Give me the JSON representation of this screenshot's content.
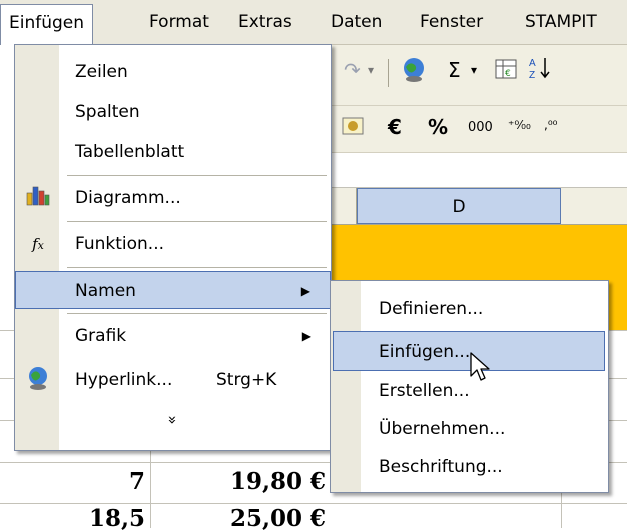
{
  "menubar": {
    "items": [
      {
        "label": "Einfügen"
      },
      {
        "label": "Format"
      },
      {
        "label": "Extras"
      },
      {
        "label": "Daten"
      },
      {
        "label": "Fenster"
      },
      {
        "label": "STAMPIT"
      }
    ]
  },
  "toolbar": {
    "sigma": "Σ",
    "euro": "€",
    "percent": "%",
    "thousands": "000",
    "dec_inc": "⁺⁰⁄₀₀",
    "dec_dec": ",⁰⁰"
  },
  "grid": {
    "column_header": "D",
    "cells": [
      {
        "value": "7",
        "amount": "19,80 €"
      },
      {
        "value": "18,5",
        "amount": "25,00 €"
      }
    ]
  },
  "menu": {
    "items": [
      {
        "label": "Zeilen"
      },
      {
        "label": "Spalten"
      },
      {
        "label": "Tabellenblatt"
      },
      {
        "label": "Diagramm..."
      },
      {
        "label": "Funktion..."
      },
      {
        "label": "Namen"
      },
      {
        "label": "Grafik"
      },
      {
        "label": "Hyperlink...",
        "shortcut": "Strg+K"
      }
    ],
    "expand": "»"
  },
  "submenu": {
    "items": [
      {
        "label": "Definieren..."
      },
      {
        "label": "Einfügen..."
      },
      {
        "label": "Erstellen..."
      },
      {
        "label": "Übernehmen..."
      },
      {
        "label": "Beschriftung..."
      }
    ]
  },
  "colors": {
    "menu_bg": "#ebe9dd",
    "highlight": "#c3d3ec",
    "highlight_border": "#4c6fb1",
    "sheet_header_fill": "#ffc200"
  }
}
